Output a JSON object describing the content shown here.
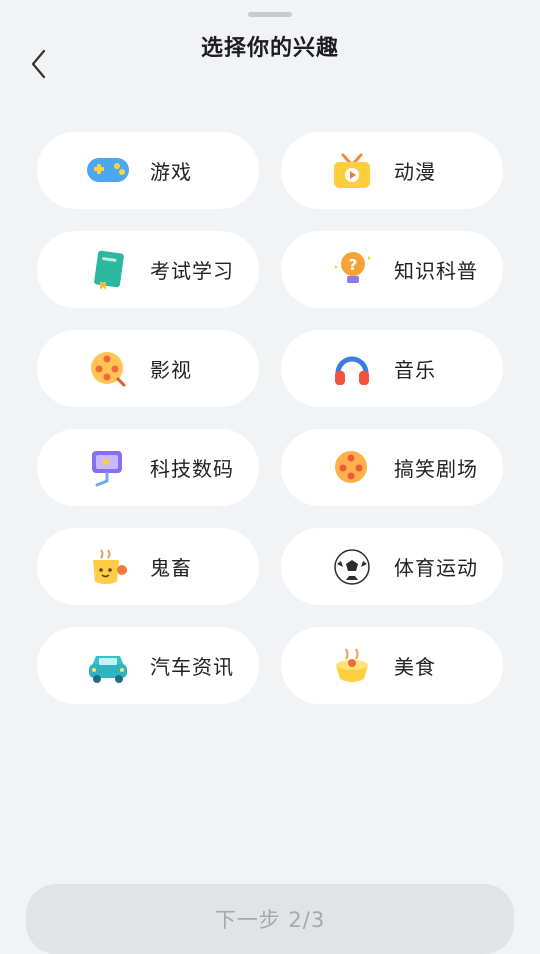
{
  "header": {
    "title": "选择你的兴趣"
  },
  "interests": [
    {
      "label": "游戏",
      "icon": "gamepad-icon"
    },
    {
      "label": "动漫",
      "icon": "tv-anime-icon"
    },
    {
      "label": "考试学习",
      "icon": "book-icon"
    },
    {
      "label": "知识科普",
      "icon": "lightbulb-icon"
    },
    {
      "label": "影视",
      "icon": "film-reel-icon"
    },
    {
      "label": "音乐",
      "icon": "headphones-icon"
    },
    {
      "label": "科技数码",
      "icon": "tech-device-icon"
    },
    {
      "label": "搞笑剧场",
      "icon": "comedy-reel-icon"
    },
    {
      "label": "鬼畜",
      "icon": "cup-face-icon"
    },
    {
      "label": "体育运动",
      "icon": "soccer-ball-icon"
    },
    {
      "label": "汽车资讯",
      "icon": "car-icon"
    },
    {
      "label": "美食",
      "icon": "food-icon"
    }
  ],
  "footer": {
    "next_label": "下一步 2/3"
  }
}
